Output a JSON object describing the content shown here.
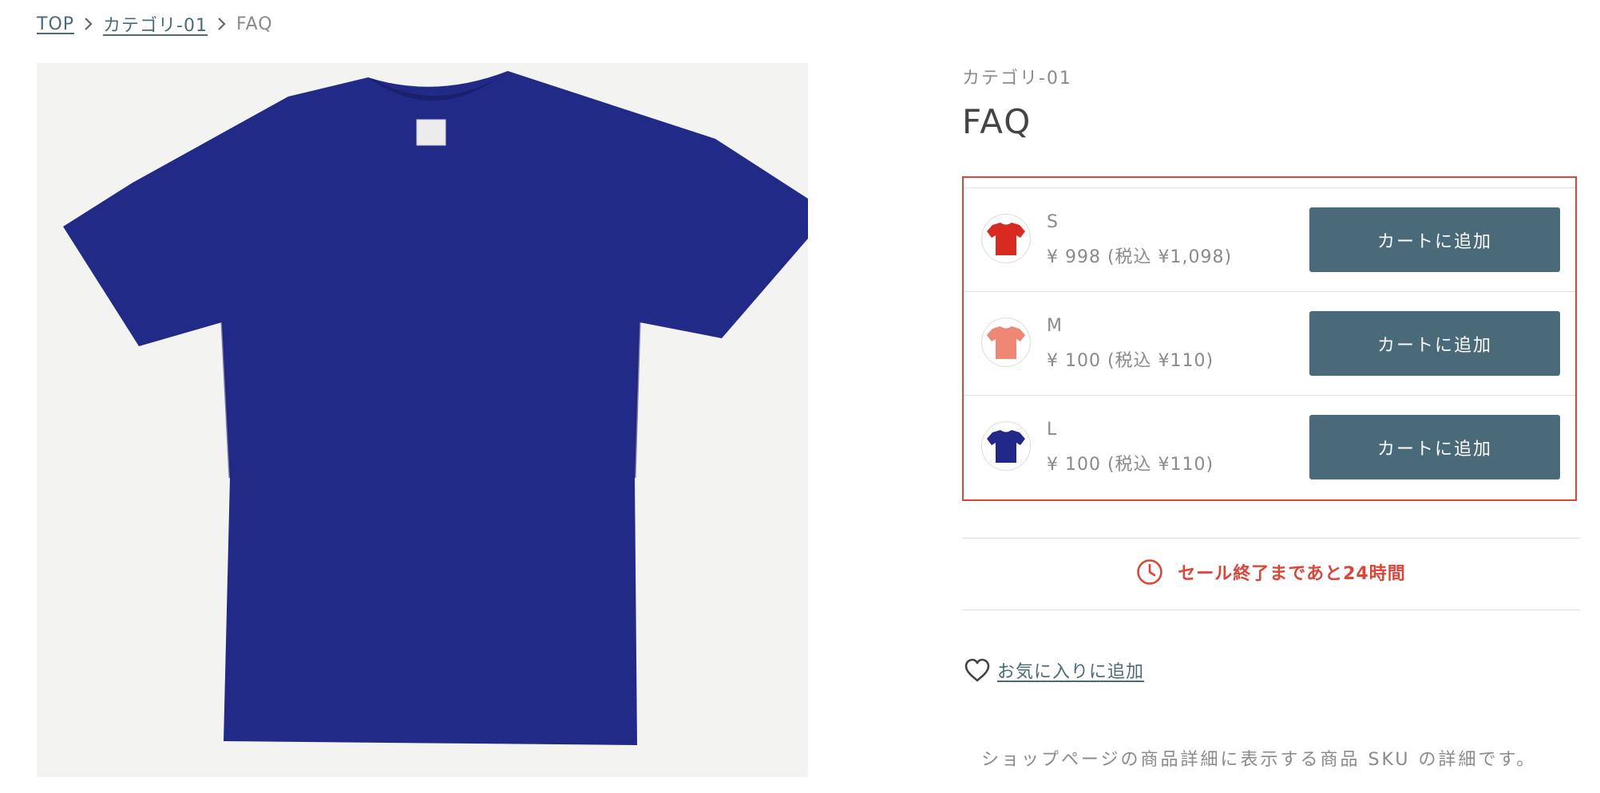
{
  "breadcrumb": {
    "items": [
      "TOP",
      "カテゴリ-01"
    ],
    "current": "FAQ"
  },
  "product": {
    "category": "カテゴリ-01",
    "title": "FAQ",
    "main_image_color": "#222a87"
  },
  "skus": [
    {
      "size": "S",
      "price": "¥ 998 (税込 ¥1,098)",
      "button": "カートに追加",
      "color": "#d92a22"
    },
    {
      "size": "M",
      "price": "¥ 100 (税込 ¥110)",
      "button": "カートに追加",
      "color": "#ee8774"
    },
    {
      "size": "L",
      "price": "¥ 100 (税込 ¥110)",
      "button": "カートに追加",
      "color": "#22278a"
    }
  ],
  "sale": {
    "text": "セール終了まであと24時間",
    "icon": "clock-icon",
    "color": "#d9463a"
  },
  "favorite": {
    "label": "お気に入りに追加",
    "icon": "heart-icon"
  },
  "description": "ショップページの商品詳細に表示する商品 SKU の詳細です。",
  "colors": {
    "accent": "#4a6a7a",
    "highlight_border": "#d9463a"
  }
}
